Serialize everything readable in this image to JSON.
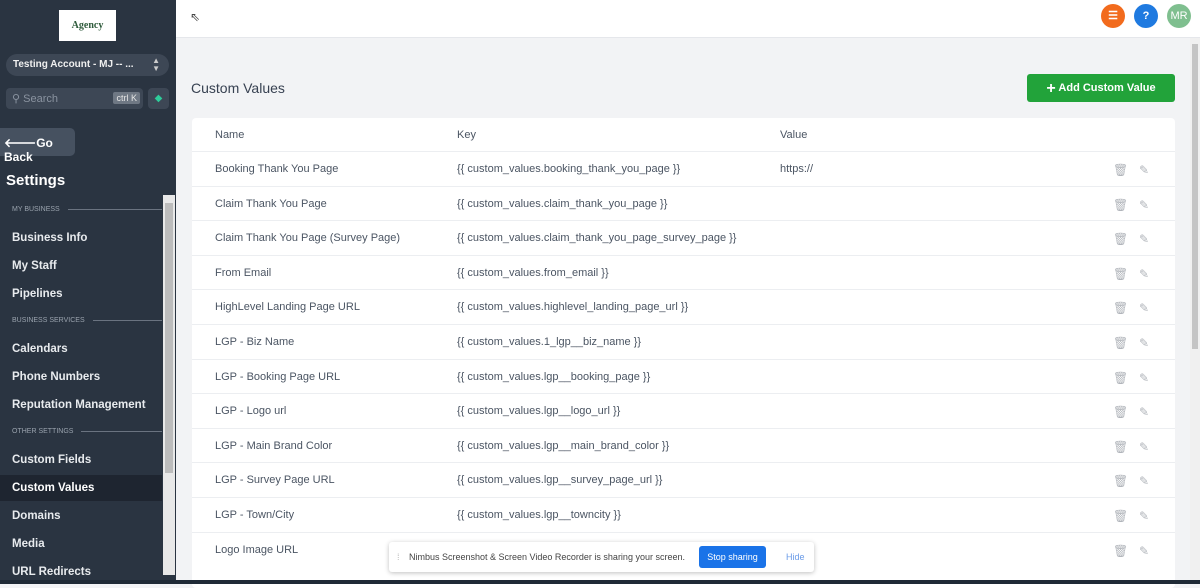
{
  "sidebar": {
    "logo": "Agency",
    "account": "Testing Account - MJ -- ...",
    "search_placeholder": "Search",
    "search_shortcut": "ctrl K",
    "go_back": "Go Back",
    "settings_title": "Settings",
    "sections": [
      {
        "label": "MY BUSINESS"
      },
      {
        "label": "BUSINESS SERVICES"
      },
      {
        "label": "OTHER SETTINGS"
      }
    ],
    "items": [
      {
        "label": "Business Info"
      },
      {
        "label": "My Staff"
      },
      {
        "label": "Pipelines"
      },
      {
        "label": "Calendars"
      },
      {
        "label": "Phone Numbers"
      },
      {
        "label": "Reputation Management"
      },
      {
        "label": "Custom Fields"
      },
      {
        "label": "Custom Values"
      },
      {
        "label": "Domains"
      },
      {
        "label": "Media"
      },
      {
        "label": "URL Redirects"
      }
    ]
  },
  "topbar": {
    "avatar": "MR",
    "help": "?"
  },
  "main": {
    "title": "Custom Values",
    "add_button": "Add Custom Value",
    "columns": [
      "Name",
      "Key",
      "Value"
    ],
    "rows": [
      {
        "name": "Booking Thank You Page",
        "key": "{{ custom_values.booking_thank_you_page }}",
        "value": "https://"
      },
      {
        "name": "Claim Thank You Page",
        "key": "{{ custom_values.claim_thank_you_page }}",
        "value": ""
      },
      {
        "name": "Claim Thank You Page (Survey Page)",
        "key": "{{ custom_values.claim_thank_you_page_survey_page }}",
        "value": ""
      },
      {
        "name": "From Email",
        "key": "{{ custom_values.from_email }}",
        "value": ""
      },
      {
        "name": "HighLevel Landing Page URL",
        "key": "{{ custom_values.highlevel_landing_page_url }}",
        "value": ""
      },
      {
        "name": "LGP - Biz Name",
        "key": "{{ custom_values.1_lgp__biz_name }}",
        "value": ""
      },
      {
        "name": "LGP - Booking Page URL",
        "key": "{{ custom_values.lgp__booking_page }}",
        "value": ""
      },
      {
        "name": "LGP - Logo url",
        "key": "{{ custom_values.lgp__logo_url }}",
        "value": ""
      },
      {
        "name": "LGP - Main Brand Color",
        "key": "{{ custom_values.lgp__main_brand_color }}",
        "value": ""
      },
      {
        "name": "LGP - Survey Page URL",
        "key": "{{ custom_values.lgp__survey_page_url }}",
        "value": ""
      },
      {
        "name": "LGP - Town/City",
        "key": "{{ custom_values.lgp__towncity }}",
        "value": ""
      },
      {
        "name": "Logo Image URL",
        "key": "",
        "value": ""
      }
    ]
  },
  "share_bar": {
    "text": "Nimbus Screenshot & Screen Video Recorder is sharing your screen.",
    "stop": "Stop sharing",
    "hide": "Hide"
  }
}
